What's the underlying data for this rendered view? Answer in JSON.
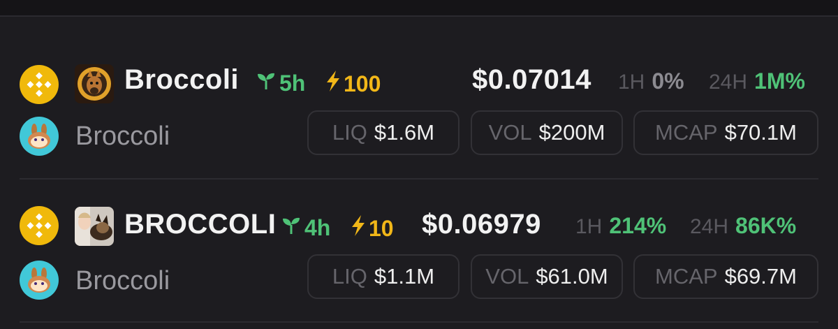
{
  "tokens": [
    {
      "name": "Broccoli",
      "age": "5h",
      "boost": "100",
      "price": "$0.07014",
      "change_1h_label": "1H",
      "change_1h": "0%",
      "change_24h_label": "24H",
      "change_24h": "1M%",
      "dex_name": "Broccoli",
      "liq_label": "LIQ",
      "liq": "$1.6M",
      "vol_label": "VOL",
      "vol": "$200M",
      "mcap_label": "MCAP",
      "mcap": "$70.1M"
    },
    {
      "name": "BROCCOLI",
      "age": "4h",
      "boost": "10",
      "price": "$0.06979",
      "change_1h_label": "1H",
      "change_1h": "214%",
      "change_24h_label": "24H",
      "change_24h": "86K%",
      "dex_name": "Broccoli",
      "liq_label": "LIQ",
      "liq": "$1.1M",
      "vol_label": "VOL",
      "vol": "$61.0M",
      "mcap_label": "MCAP",
      "mcap": "$69.7M"
    }
  ],
  "colors": {
    "background": "#1d1c20",
    "positive": "#4fc277",
    "neutral": "#8c8b91",
    "boost": "#f2b718",
    "bnb": "#f0b90b",
    "pancakeswap": "#41c8d8"
  },
  "icons": {
    "chain": "bnb-chain-icon",
    "dex": "pancakeswap-icon",
    "age": "sprout-icon",
    "boost": "lightning-icon"
  }
}
